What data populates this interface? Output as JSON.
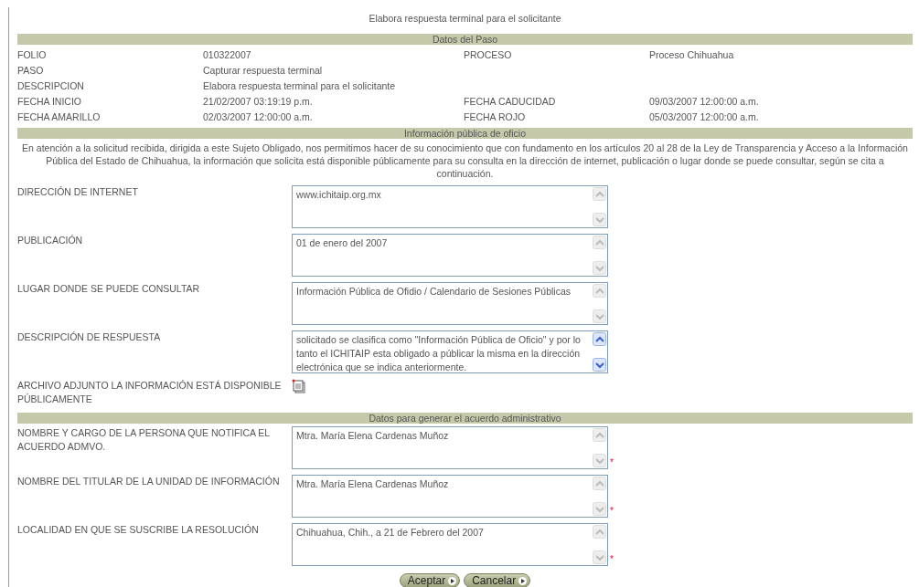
{
  "title": "Elabora respuesta terminal para el solicitante",
  "sections": [
    {
      "heading": "Datos del Paso",
      "kind": "info",
      "rows": [
        {
          "label_1": "FOLIO",
          "value_1": "010322007",
          "label_2": "PROCESO",
          "value_2": "Proceso Chihuahua"
        },
        {
          "label_1": "PASO",
          "value_1": "Capturar respuesta terminal"
        },
        {
          "label_1": "DESCRIPCION",
          "value_1": "Elabora respuesta terminal para el solicitante"
        },
        {
          "label_1": "FECHA INICIO",
          "value_1": "21/02/2007 03:19:19 p.m.",
          "label_2": "FECHA CADUCIDAD",
          "value_2": "09/03/2007 12:00:00 a.m."
        },
        {
          "label_1": "FECHA AMARILLO",
          "value_1": "02/03/2007 12:00:00 a.m.",
          "label_2": "FECHA ROJO",
          "value_2": "05/03/2007 12:00:00 a.m."
        }
      ]
    },
    {
      "heading": "Información pública de oficio",
      "kind": "form",
      "intro": "En atención a la solicitud recibida, dirigida a este Sujeto Obligado, nos permitimos hacer de su conocimiento que con fundamento en los artículos 20 al 28 de la Ley de Transparencia y Acceso a la Información Pública del Estado de Chihuahua, la información que solicita está disponible públicamente para su consulta en la dirección de internet, publicación o lugar donde se puede consultar, según se cita a continuación.",
      "fields": [
        {
          "kind": "textarea",
          "label": "DIRECCIÓN DE INTERNET",
          "value": "www.ichitaip.org.mx",
          "scrollbar_active": false
        },
        {
          "kind": "textarea",
          "label": "PUBLICACIÓN",
          "value": "01 de enero del 2007",
          "scrollbar_active": false
        },
        {
          "kind": "textarea",
          "label": "LUGAR DONDE SE PUEDE CONSULTAR",
          "value": "Información Pública de Ofidio / Calendario de Sesiones Públicas",
          "scrollbar_active": false
        },
        {
          "kind": "textarea",
          "label": "DESCRIPCIÓN DE RESPUESTA",
          "value": "solicitado se clasifica como \"Información Pública de Oficio\" y por lo tanto el ICHITAIP esta obligado a públicar la misma en la dirección electrónica que se indica anteriormente.",
          "scrollbar_active": true
        },
        {
          "kind": "attachment",
          "label": "ARCHIVO ADJUNTO LA INFORMACIÓN ESTÁ DISPONIBLE PÚBLICAMENTE"
        }
      ]
    },
    {
      "heading": "Datos para generar el acuerdo administrativo",
      "kind": "form",
      "fields": [
        {
          "kind": "textarea",
          "label": "NOMBRE Y CARGO DE LA PERSONA QUE NOTIFICA EL ACUERDO ADMVO.",
          "value": "Mtra. María Elena Cardenas Muñoz",
          "scrollbar_active": false,
          "required_mark": "*"
        },
        {
          "kind": "textarea",
          "label": "NOMBRE DEL TITULAR DE LA UNIDAD DE INFORMACIÓN",
          "value": "Mtra. María Elena Cardenas Muñoz",
          "scrollbar_active": false,
          "required_mark": "*"
        },
        {
          "kind": "textarea",
          "label": "LOCALIDAD EN QUE SE SUSCRIBE LA RESOLUCIÓN",
          "value": "Chihuahua, Chih., a 21 de Febrero del 2007",
          "scrollbar_active": false,
          "required_mark": "*"
        }
      ]
    }
  ],
  "buttons": [
    "Aceptar",
    "Cancelar"
  ]
}
